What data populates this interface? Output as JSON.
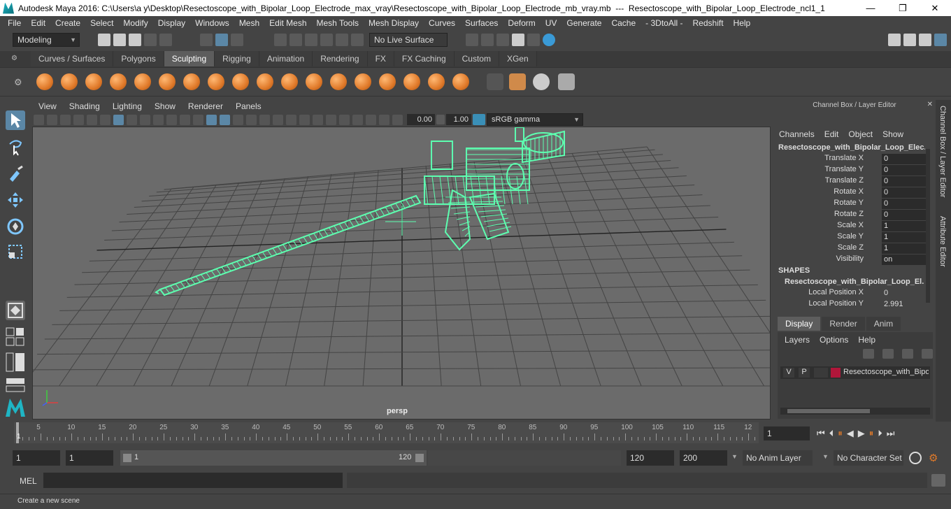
{
  "title_bar": {
    "text": "Autodesk Maya 2016: C:\\Users\\a y\\Desktop\\Resectoscope_with_Bipolar_Loop_Electrode_max_vray\\Resectoscope_with_Bipolar_Loop_Electrode_mb_vray.mb  ---  Resectoscope_with_Bipolar_Loop_Electrode_ncl1_1",
    "minimize": "—",
    "maximize": "❐",
    "close": "✕"
  },
  "menu": [
    "File",
    "Edit",
    "Create",
    "Select",
    "Modify",
    "Display",
    "Windows",
    "Mesh",
    "Edit Mesh",
    "Mesh Tools",
    "Mesh Display",
    "Curves",
    "Surfaces",
    "Deform",
    "UV",
    "Generate",
    "Cache",
    "- 3DtoAll -",
    "Redshift",
    "Help"
  ],
  "status_line": {
    "mode": "Modeling",
    "live_surface": "No Live Surface"
  },
  "shelf_tabs": [
    {
      "label": "Curves / Surfaces",
      "active": false
    },
    {
      "label": "Polygons",
      "active": false
    },
    {
      "label": "Sculpting",
      "active": true
    },
    {
      "label": "Rigging",
      "active": false
    },
    {
      "label": "Animation",
      "active": false
    },
    {
      "label": "Rendering",
      "active": false
    },
    {
      "label": "FX",
      "active": false
    },
    {
      "label": "FX Caching",
      "active": false
    },
    {
      "label": "Custom",
      "active": false
    },
    {
      "label": "XGen",
      "active": false
    }
  ],
  "viewport": {
    "menu": [
      "View",
      "Shading",
      "Lighting",
      "Show",
      "Renderer",
      "Panels"
    ],
    "exposure": "0.00",
    "gamma": "1.00",
    "color_space": "sRGB gamma",
    "camera_label": "persp",
    "wire_color": "#5dffb0"
  },
  "channel_box": {
    "header": "Channel Box / Layer Editor",
    "menu": [
      "Channels",
      "Edit",
      "Object",
      "Show"
    ],
    "object_name": "Resectoscope_with_Bipolar_Loop_Elec...",
    "attributes": [
      {
        "name": "Translate X",
        "value": "0"
      },
      {
        "name": "Translate Y",
        "value": "0"
      },
      {
        "name": "Translate Z",
        "value": "0"
      },
      {
        "name": "Rotate X",
        "value": "0"
      },
      {
        "name": "Rotate Y",
        "value": "0"
      },
      {
        "name": "Rotate Z",
        "value": "0"
      },
      {
        "name": "Scale X",
        "value": "1"
      },
      {
        "name": "Scale Y",
        "value": "1"
      },
      {
        "name": "Scale Z",
        "value": "1"
      },
      {
        "name": "Visibility",
        "value": "on"
      }
    ],
    "shapes_label": "SHAPES",
    "shape_name": "Resectoscope_with_Bipolar_Loop_El...",
    "shape_attributes": [
      {
        "name": "Local Position X",
        "value": "0"
      },
      {
        "name": "Local Position Y",
        "value": "2.991"
      }
    ]
  },
  "layer_editor": {
    "tabs": [
      {
        "label": "Display",
        "active": true
      },
      {
        "label": "Render",
        "active": false
      },
      {
        "label": "Anim",
        "active": false
      }
    ],
    "menu": [
      "Layers",
      "Options",
      "Help"
    ],
    "layer": {
      "v": "V",
      "p": "P",
      "name": "Resectoscope_with_Bipo",
      "color": "#b0163a"
    }
  },
  "side_tabs": {
    "channel_box": "Channel Box / Layer Editor",
    "attribute_editor": "Attribute Editor"
  },
  "timeline": {
    "labels": [
      "5",
      "10",
      "15",
      "20",
      "25",
      "30",
      "35",
      "40",
      "45",
      "50",
      "55",
      "60",
      "65",
      "70",
      "75",
      "80",
      "85",
      "90",
      "95",
      "100",
      "105",
      "110",
      "115",
      "12"
    ],
    "current_frame_marker": "1",
    "current_frame": "1"
  },
  "range": {
    "start": "1",
    "playback_start": "1",
    "slider_start": "1",
    "slider_end": "120",
    "playback_end": "120",
    "end": "200",
    "anim_layer": "No Anim Layer",
    "character_set": "No Character Set"
  },
  "command_line": {
    "label": "MEL"
  },
  "help_line": "Create a new scene"
}
